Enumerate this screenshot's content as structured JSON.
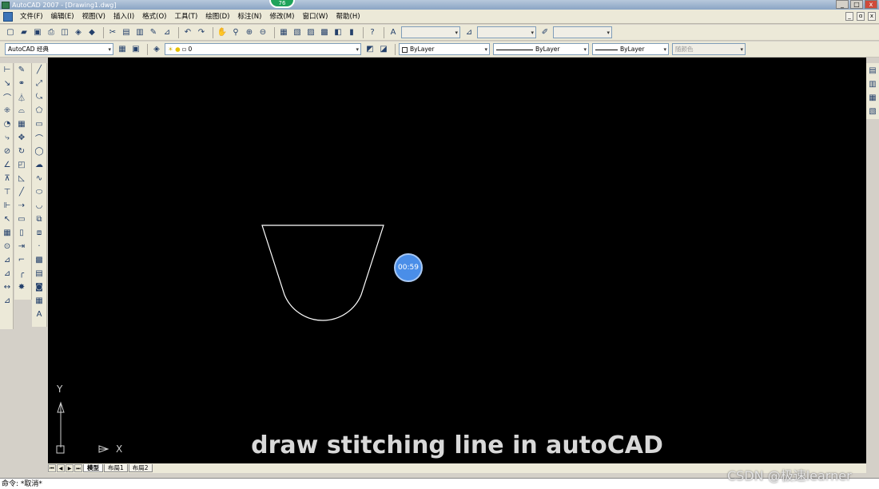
{
  "window": {
    "title": "AutoCAD 2007 - [Drawing1.dwg]",
    "badge": "76",
    "controls": {
      "minimize": "_",
      "maximize": "□",
      "close": "x"
    }
  },
  "menu": {
    "items": [
      "文件(F)",
      "编辑(E)",
      "视图(V)",
      "插入(I)",
      "格式(O)",
      "工具(T)",
      "绘图(D)",
      "标注(N)",
      "修改(M)",
      "窗口(W)",
      "帮助(H)"
    ],
    "mdi_controls": [
      "_",
      "ɑ",
      "x"
    ]
  },
  "toolbar2": {
    "workspace": "AutoCAD 经典",
    "layer": "0",
    "color": "ByLayer",
    "linetype": "ByLayer",
    "lineweight": "ByLayer",
    "plotstyle": "随颜色"
  },
  "canvas": {
    "timer": "00:59",
    "caption": "draw stitching line in autoCAD",
    "ucs_y": "Y",
    "ucs_x": "X"
  },
  "layout_tabs": [
    "模型",
    "布局1",
    "布局2"
  ],
  "command_line": "命令: *取消*",
  "watermark": "CSDN @极速learner"
}
